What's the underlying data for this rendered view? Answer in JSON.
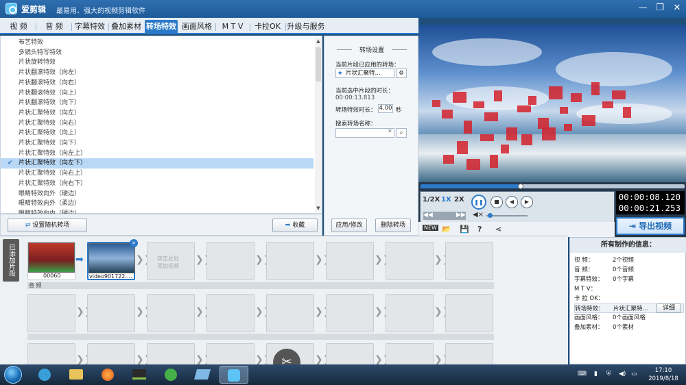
{
  "window": {
    "title": "爱剪辑",
    "slogan": "最易用、强大的视频剪辑软件",
    "min": "—",
    "max": "❐",
    "close": "✕"
  },
  "tabs": [
    "视 频",
    "音 频",
    "字幕特效",
    "叠加素材",
    "转场特效",
    "画面风格",
    "M T V",
    "卡拉OK",
    "升级与服务"
  ],
  "active_tab": "转场特效",
  "transitions": [
    "布艺特效",
    "多镜头特写特效",
    "片状旋转特效",
    "片状翻滚特效（向左）",
    "片状翻滚特效（向右）",
    "片状翻滚特效（向上）",
    "片状翻滚特效（向下）",
    "片状汇聚特效（向左）",
    "片状汇聚特效（向右）",
    "片状汇聚特效（向上）",
    "片状汇聚特效（向下）",
    "片状汇聚特效（向左上）",
    "片状汇聚特效（向左下）",
    "片状汇聚特效（向右上）",
    "片状汇聚特效（向右下）",
    "眼睛特效向外（硬边）",
    "眼睛特效向外（柔边）",
    "眼睛特效向内（硬边）"
  ],
  "selected_transition": "片状汇聚特效（向左下）",
  "list_buttons": {
    "random": "设置随机转场",
    "collect": "收藏"
  },
  "settings": {
    "title": "转场设置",
    "applied_label": "当前片段已应用的转场：",
    "applied_value": "片状汇聚特...",
    "duration_label": "当前选中片段的时长：",
    "duration_value": "00:00:13.813",
    "effect_duration_label": "转场特效时长：",
    "effect_duration_value": "4.00",
    "effect_duration_unit": "秒",
    "search_label": "搜索转场名称：",
    "search_value": "",
    "apply_button": "应用/修改",
    "delete_button": "删除转场"
  },
  "player": {
    "speeds": [
      "1/2X",
      "1X",
      "2X"
    ],
    "active_speed": "1X",
    "progress": 0.38,
    "current_time": "00:00:08.120",
    "total_time": "00:00:21.253",
    "export_label": "导出视频"
  },
  "timeline": {
    "side_label": "已添加片段",
    "clips": [
      {
        "label": "00060"
      },
      {
        "label": "video901722...."
      }
    ],
    "empty_slot_text": "双击此处\n添加视频",
    "audio_label": "音 频"
  },
  "info": {
    "title": "所有制作的信息：",
    "rows": [
      {
        "k": "视    频：",
        "v": "2个视频"
      },
      {
        "k": "音    频：",
        "v": "0个音频"
      },
      {
        "k": "字幕特效：",
        "v": "0个字幕"
      },
      {
        "k": "M  T  V：",
        "v": ""
      },
      {
        "k": "卡 拉 OK：",
        "v": ""
      },
      {
        "k": "转场特效：",
        "v": "片状汇聚特..."
      },
      {
        "k": "画面风格：",
        "v": "0个画面风格"
      },
      {
        "k": "叠加素材：",
        "v": "0个素材"
      }
    ],
    "detail_button": "详细"
  },
  "taskbar": {
    "time": "17:10",
    "date": "2019/8/18"
  },
  "colors": {
    "accent": "#2b7ac9",
    "titlebar": "#1d5a98",
    "selected_row": "#b9d8f5"
  }
}
